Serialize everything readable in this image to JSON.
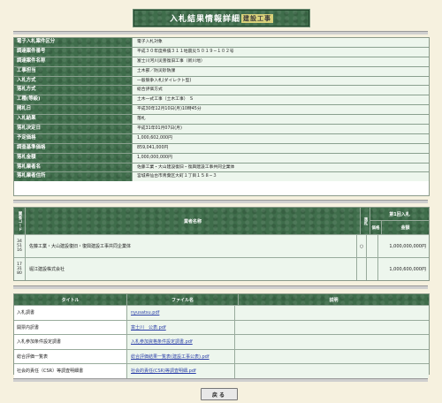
{
  "header": {
    "title": "入札結果情報詳細",
    "subtitle": "建設工事"
  },
  "detail": [
    {
      "label": "電子入札案件区分",
      "value": "電子入札対象"
    },
    {
      "label": "調達案件番号",
      "value": "平成３０年度県債３１１地震災５０１９−１０２号"
    },
    {
      "label": "調達案件名称",
      "value": "富士川河川災害復旧工事（新川地）"
    },
    {
      "label": "工事担当",
      "value": "土木部／防災砂防課"
    },
    {
      "label": "入札方式",
      "value": "一般競争入札(ダイレクト型)"
    },
    {
      "label": "落札方式",
      "value": "総合評価方式"
    },
    {
      "label": "工種(等級)",
      "value": "土木一式工事（土木工事）　S"
    },
    {
      "label": "開札日",
      "value": "平成30年12月10日(月)10時45分"
    },
    {
      "label": "入札結果",
      "value": "落札"
    },
    {
      "label": "落札決定日",
      "value": "平成31年01月07日(月)"
    },
    {
      "label": "予定価格",
      "value": "1,000,602,000円"
    },
    {
      "label": "調査基準価格",
      "value": "859,041,000円"
    },
    {
      "label": "落札金額",
      "value": "1,000,000,000円"
    },
    {
      "label": "落札業者名",
      "value": "佐藤工業・大山建設復旧・復興建設工事共同企業体"
    },
    {
      "label": "落札業者住所",
      "value": "宮城県仙台市青葉区大町１丁目１５８−３"
    }
  ],
  "bidders": {
    "col_no": "業者コード",
    "col_name": "業者名称",
    "col_mark": "落札",
    "col_group": "第1回入札",
    "col_sub": "価格",
    "col_amount": "金額",
    "rows": [
      {
        "code": "34 51 16",
        "name": "佐藤工業・大山建設復旧・復興建設工事共同企業体",
        "mark": "○",
        "amount": "1,000,000,000円"
      },
      {
        "code": "17 31 80",
        "name": "堀江建設株式会社",
        "mark": "",
        "amount": "1,000,600,000円"
      }
    ]
  },
  "files": {
    "col_title": "タイトル",
    "col_file": "ファイル名",
    "col_note": "説明",
    "rows": [
      {
        "title": "入札調書",
        "file": "nyusatsu.pdf"
      },
      {
        "title": "開票内訳書",
        "file": "富士川　公表.pdf"
      },
      {
        "title": "入札参加条件設定調書",
        "file": "入札参加資格条件設定調書.pdf"
      },
      {
        "title": "総合評価一覧表",
        "file": "総合評価結果一覧表(建設工事公表).pdf"
      },
      {
        "title": "社会的責任（CSR）等調査明細書",
        "file": "社会的責任(CSR)等調査明細.pdf"
      }
    ]
  },
  "buttons": {
    "back": "戻る"
  }
}
